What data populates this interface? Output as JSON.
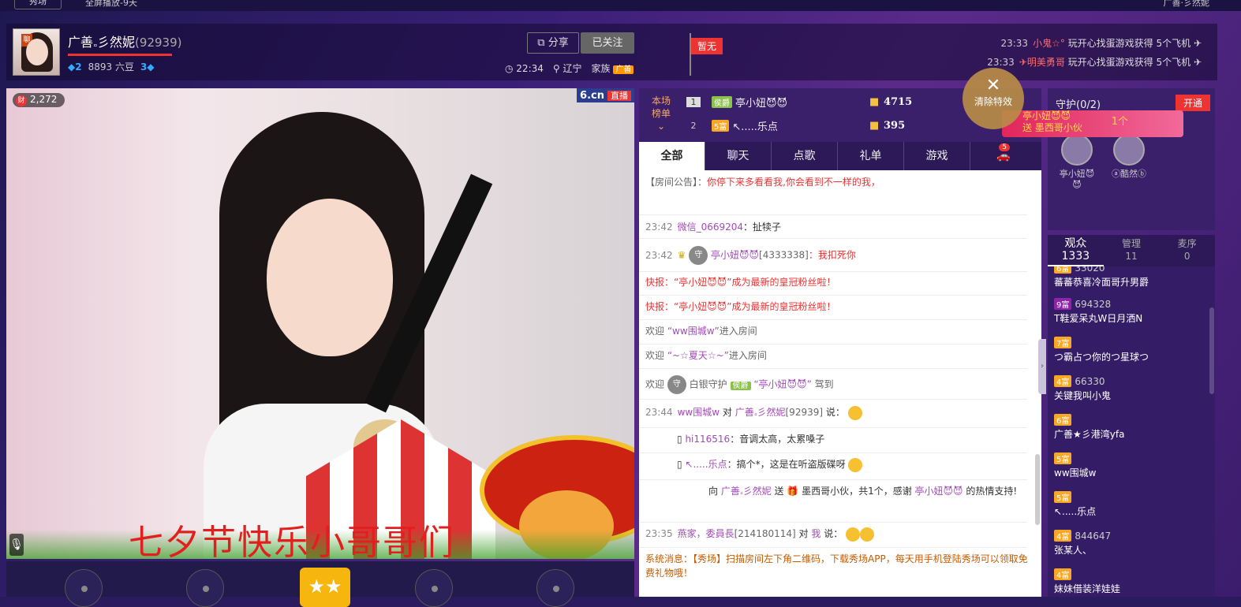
{
  "topbar": {
    "logo": "秀场",
    "menu": "全屏播放-9天",
    "user": "广善·彡然妮"
  },
  "anchor": {
    "badge": "聊",
    "name": "广善𝅆彡然妮",
    "id": "(92939)",
    "diamond1": "2",
    "douzi": "8893 六豆",
    "diamond2": "3",
    "time": "22:34",
    "location": "辽宁",
    "family_label": "家族",
    "family_tag": "广善"
  },
  "header": {
    "share_label": "分享",
    "follow_label": "已关注",
    "flag_label": "暂无"
  },
  "notices": [
    {
      "time": "23:33",
      "name": "小鬼☆°",
      "text": "玩开心找蛋游戏获得 5个飞机"
    },
    {
      "time": "23:33",
      "name": "✈明美勇哥",
      "text": "玩开心找蛋游戏获得 5个飞机"
    }
  ],
  "video": {
    "wealth": "2,272",
    "wealth_icon": "财",
    "logo": "6.cn",
    "live": "直播",
    "caption": "七夕节快乐小哥哥们",
    "mic_icon": "microphone-icon"
  },
  "rank": {
    "title1": "本场",
    "title2": "榜单",
    "rows": [
      {
        "no": "1",
        "lv": "侯爵",
        "name": "亭小妞😈😈",
        "score": "4715"
      },
      {
        "no": "2",
        "lv": "5富",
        "name": "↖.....乐点",
        "score": "395"
      }
    ]
  },
  "clear_fx": {
    "label": "清除特效"
  },
  "gift_banner": {
    "line1": "亭小妞😈😈",
    "line2": "送 墨西哥小伙",
    "count": "1个"
  },
  "tabs": [
    "全部",
    "聊天",
    "点歌",
    "礼单",
    "游戏"
  ],
  "car_count": "5",
  "chat": {
    "announce_label": "【房间公告】：",
    "announce_text": "你停下来多看看我,你会看到不一样的我，",
    "m1_time": "23:42",
    "m1_user": "微信_0669204",
    "m1_text": "：扯犊子",
    "m2_time": "23:42",
    "m2_user": "亭小妞😈😈",
    "m2_id": "[4333338]",
    "m2_text": "：我扣死你",
    "m3": "快报：“亭小妞😈😈”成为最新的皇冠粉丝啦！",
    "m4": "快报：“亭小妞😈😈”成为最新的皇冠粉丝啦！",
    "m5_pre": "欢迎",
    "m5_user": "“ww围城w”",
    "m5_post": "进入房间",
    "m6_pre": "欢迎",
    "m6_user": "“~☆夏天☆~”",
    "m6_post": "进入房间",
    "m7_pre": "欢迎",
    "m7_mid": "白银守护",
    "m7_lv": "侯爵",
    "m7_user": "“亭小妞😈😈”",
    "m7_post": "驾到",
    "m8_time": "23:44",
    "m8_user": "ww围城w",
    "m8_mid": "对",
    "m8_target": "广善𝅆彡然妮",
    "m8_id": "[92939]",
    "m8_post": "说：",
    "m9_user": "hi116516",
    "m9_text": "：音调太高，太累嗓子",
    "m10_user": "↖.....乐点",
    "m10_text": "：搞个*，这是在听盗版碟呀",
    "m11_pre": "向",
    "m11_target": "广善𝅆彡然妮",
    "m11_mid": "送",
    "m11_gift": "墨西哥小伙，共1个，感谢",
    "m11_user": "亭小妞😈😈",
    "m11_post": "的热情支持!",
    "m12_time": "23:35",
    "m12_user": "燕家，委員長",
    "m12_id": "[214180114]",
    "m12_mid": "对",
    "m12_target": "我",
    "m12_post": "说：",
    "sys_label": "系统消息：",
    "sys_text": "【秀场】扫描房间左下角二维码，下载秀场APP，每天用手机登陆秀场可以领取免费礼物哦！"
  },
  "guard": {
    "title": "守护",
    "count": "(0/2)",
    "open_label": "开通",
    "members": [
      "亭小妞😈😈",
      "ⓐ酷然ⓑ"
    ]
  },
  "audience_tabs": [
    {
      "label": "观众",
      "count": "1333"
    },
    {
      "label": "管理",
      "count": "11"
    },
    {
      "label": "麦序",
      "count": "0"
    }
  ],
  "audience": [
    {
      "lv": "6富",
      "num": "33020",
      "name": "蕃蕃恭喜冷面哥升男爵"
    },
    {
      "lv": "9富",
      "num": "694328",
      "name": "T鞋爱呆丸W日月洒N"
    },
    {
      "lv": "7富",
      "num": "",
      "name": "つ霸占つ你的つ星球つ"
    },
    {
      "lv": "4富",
      "num": "66330",
      "name": "关键我叫小鬼"
    },
    {
      "lv": "6富",
      "num": "",
      "name": "广善★彡港湾yfa"
    },
    {
      "lv": "5富",
      "num": "",
      "name": "ww围城w"
    },
    {
      "lv": "5富",
      "num": "",
      "name": "↖.....乐点"
    },
    {
      "lv": "4富",
      "num": "844647",
      "name": "张某人、"
    },
    {
      "lv": "4富",
      "num": "",
      "name": "妹妹借装洋娃娃"
    }
  ]
}
